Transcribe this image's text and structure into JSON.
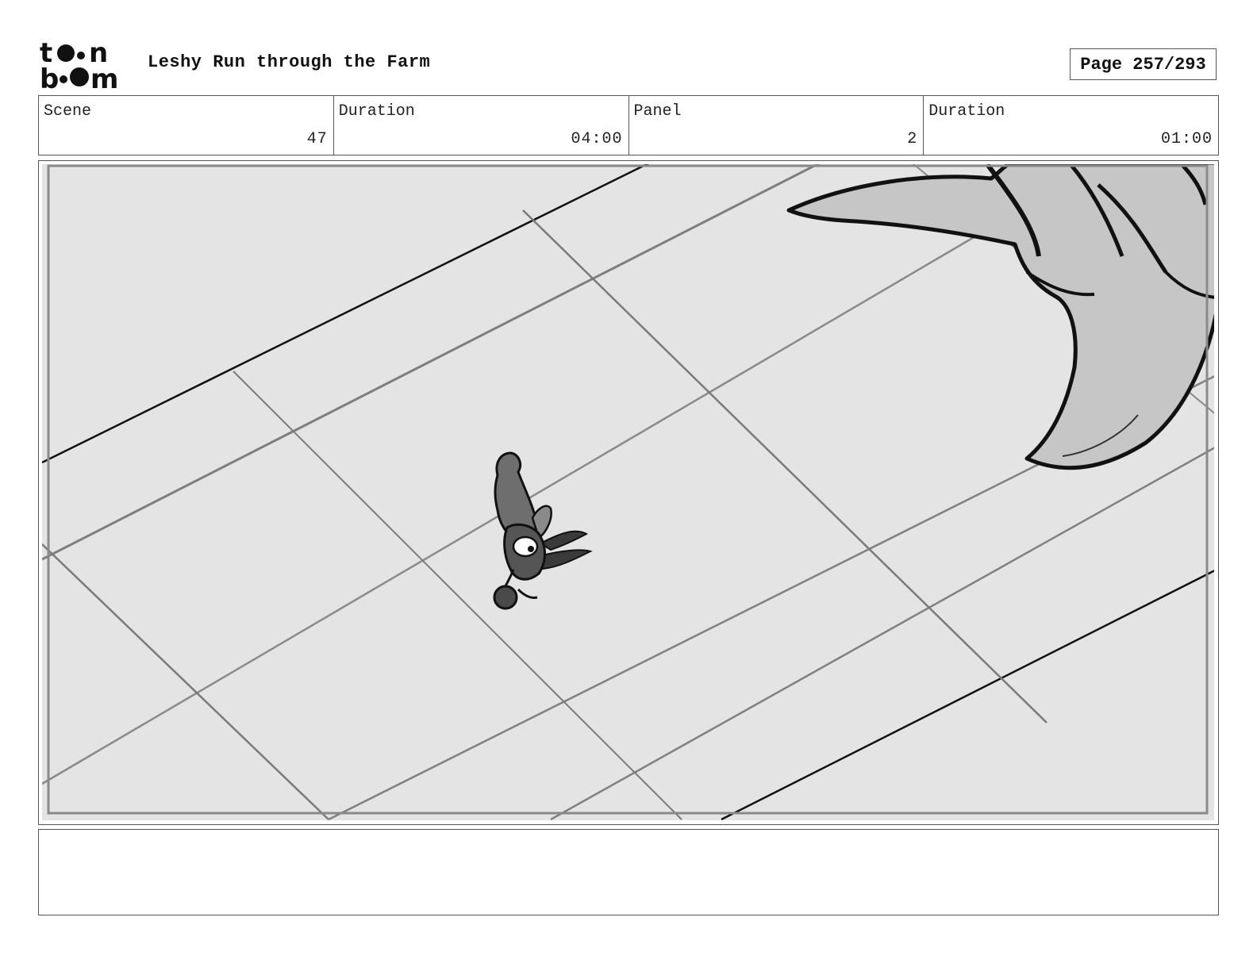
{
  "header": {
    "logo_text": "toon boom",
    "title": "Leshy Run through the Farm",
    "page_label": "Page 257/293"
  },
  "info": [
    {
      "label": "Scene",
      "value": "47"
    },
    {
      "label": "Duration",
      "value": "04:00"
    },
    {
      "label": "Panel",
      "value": "2"
    },
    {
      "label": "Duration",
      "value": "01:00"
    }
  ],
  "panel": {
    "drawing": "storyboard-sketch",
    "colors": {
      "floor": "#e4e4e4",
      "ink": "#111111",
      "tail": "#c6c6c6",
      "grid": "#808080"
    }
  },
  "notes": {
    "text": ""
  }
}
